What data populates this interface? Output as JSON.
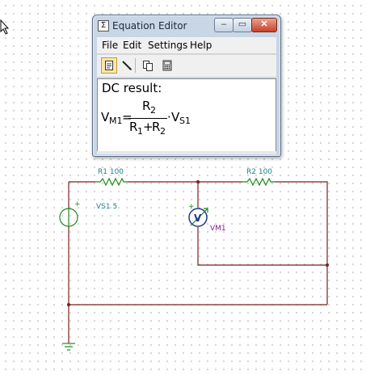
{
  "window": {
    "title": "Equation Editor",
    "min_glyph": "–",
    "max_glyph": "▭",
    "close_glyph": "✕"
  },
  "menu": {
    "file": "File",
    "edit": "Edit",
    "settings": "Settings",
    "help": "Help"
  },
  "toolbar": {
    "icons": [
      "page-icon",
      "pen-icon",
      "copy-icon",
      "calculator-icon"
    ]
  },
  "result": {
    "label": "DC result:",
    "lhs": "V",
    "lhs_sub": "M1",
    "equals": "=",
    "num": "R",
    "num_sub": "2",
    "den_r1": "R",
    "den_r1_sub": "1",
    "plus": "+",
    "den_r2": "R",
    "den_r2_sub": "2",
    "dot": "·",
    "vs": "V",
    "vs_sub": "S1"
  },
  "circuit": {
    "r1_label": "R1 100",
    "r2_label": "R2 100",
    "vs_label": "VS1 5",
    "vm_label": "VM1",
    "vm_symbol": "V",
    "plus_sign": "+",
    "colors": {
      "wire": "#7b1e1e",
      "component": "#1f8a1f",
      "label_teal": "#1e7f87",
      "label_purple": "#8c1c8c",
      "meter_ring": "#1e3a8a"
    }
  }
}
